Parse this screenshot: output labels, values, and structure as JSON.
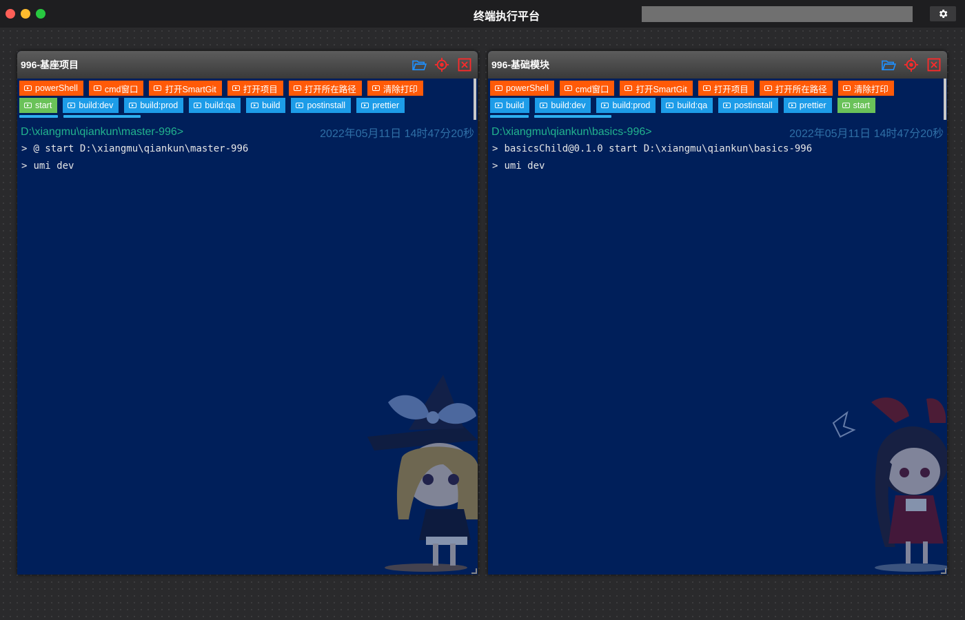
{
  "window": {
    "title": "终端执行平台",
    "search_value": "",
    "settings_icon": "gear-icon"
  },
  "colors": {
    "orange_button": "#ff5a08",
    "blue_button": "#1d9ce8",
    "green_button": "#6ac259",
    "terminal_bg": "#001f5a",
    "path_text": "#22b38e",
    "timestamp_text": "#2f6fa6"
  },
  "panels": [
    {
      "title": "996-基座项目",
      "tools": [
        "folder-open-icon",
        "target-icon",
        "close-box-icon"
      ],
      "row1": [
        "powerShell",
        "cmd窗口",
        "打开SmartGit",
        "打开项目",
        "打开所在路径",
        "清除打印"
      ],
      "row2": [
        {
          "label": "start",
          "color": "green"
        },
        {
          "label": "build:dev",
          "color": "blue"
        },
        {
          "label": "build:prod",
          "color": "blue"
        },
        {
          "label": "build:qa",
          "color": "blue"
        },
        {
          "label": "build",
          "color": "blue"
        },
        {
          "label": "postinstall",
          "color": "blue"
        },
        {
          "label": "prettier",
          "color": "blue"
        }
      ],
      "cwd": "D:\\xiangmu\\qiankun\\master-996>",
      "timestamp": "2022年05月11日 14时47分20秒",
      "lines": [
        "@ start D:\\xiangmu\\qiankun\\master-996",
        "umi dev"
      ],
      "prompt": ">"
    },
    {
      "title": "996-基础模块",
      "tools": [
        "folder-open-icon",
        "target-icon",
        "close-box-icon"
      ],
      "row1": [
        "powerShell",
        "cmd窗口",
        "打开SmartGit",
        "打开项目",
        "打开所在路径",
        "清除打印"
      ],
      "row2": [
        {
          "label": "build",
          "color": "blue"
        },
        {
          "label": "build:dev",
          "color": "blue"
        },
        {
          "label": "build:prod",
          "color": "blue"
        },
        {
          "label": "build:qa",
          "color": "blue"
        },
        {
          "label": "postinstall",
          "color": "blue"
        },
        {
          "label": "prettier",
          "color": "blue"
        },
        {
          "label": "start",
          "color": "green"
        }
      ],
      "cwd": "D:\\xiangmu\\qiankun\\basics-996>",
      "timestamp": "2022年05月11日 14时47分20秒",
      "lines": [
        "basicsChild@0.1.0 start D:\\xiangmu\\qiankun\\basics-996",
        "umi dev"
      ],
      "prompt": ">"
    }
  ]
}
